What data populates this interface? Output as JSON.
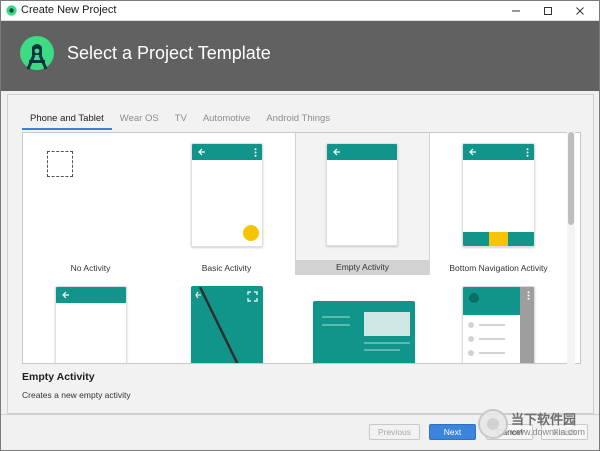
{
  "window": {
    "title": "Create New Project"
  },
  "header": {
    "title": "Select a Project Template"
  },
  "tabs": [
    {
      "label": "Phone and Tablet",
      "active": true
    },
    {
      "label": "Wear OS",
      "active": false
    },
    {
      "label": "TV",
      "active": false
    },
    {
      "label": "Automotive",
      "active": false
    },
    {
      "label": "Android Things",
      "active": false
    }
  ],
  "templates": [
    {
      "label": "No Activity"
    },
    {
      "label": "Basic Activity"
    },
    {
      "label": "Empty Activity",
      "selected": true
    },
    {
      "label": "Bottom Navigation Activity"
    }
  ],
  "description": {
    "title": "Empty Activity",
    "text": "Creates a new empty activity"
  },
  "buttons": {
    "previous": "Previous",
    "next": "Next",
    "cancel": "Cancel",
    "finish": "Finish"
  },
  "watermark": {
    "name": "当下软件园",
    "url": "www.downxia.com"
  },
  "colors": {
    "accent": "#11958a",
    "fab": "#f7c500",
    "primary_button": "#3b85dc",
    "header": "#616161"
  }
}
